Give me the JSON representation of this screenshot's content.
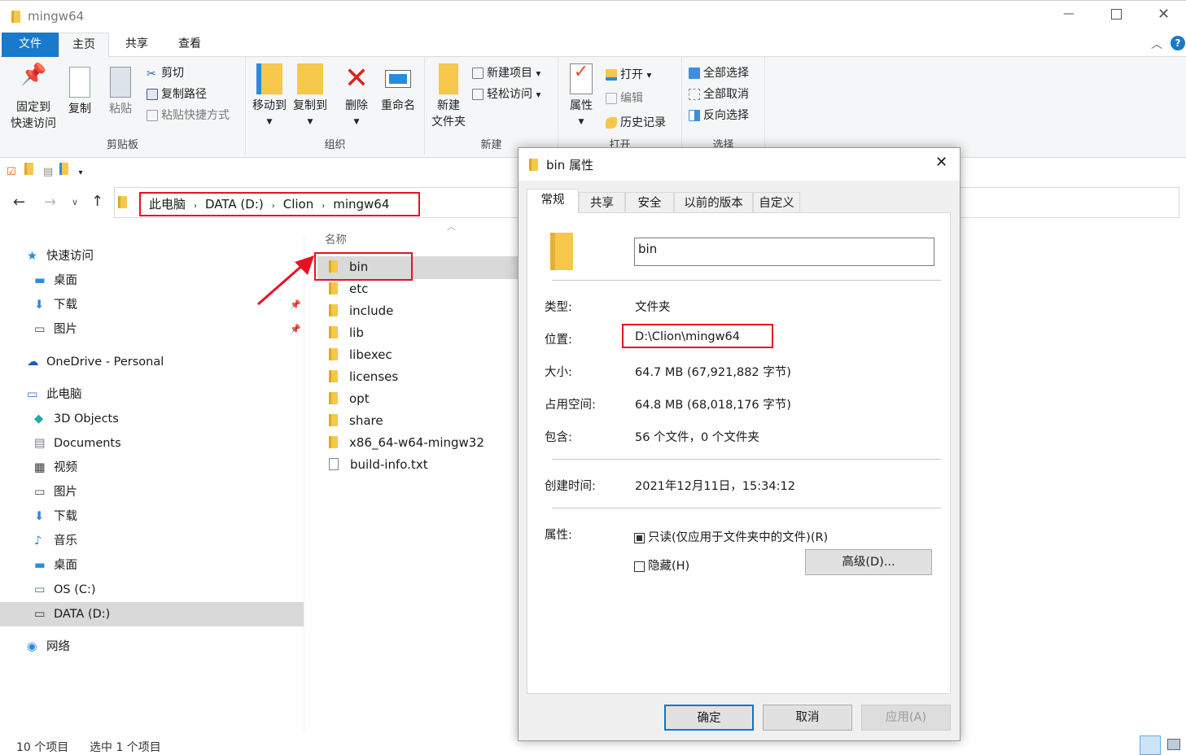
{
  "window": {
    "title": "mingw64"
  },
  "tabs": [
    "文件",
    "主页",
    "共享",
    "查看"
  ],
  "ribbon": {
    "clipboard": {
      "label": "剪贴板",
      "pin": "固定到\n快速访问",
      "copy": "复制",
      "paste": "粘贴",
      "cut": "剪切",
      "copy_path": "复制路径",
      "paste_shortcut": "粘贴快捷方式"
    },
    "organize": {
      "label": "组织",
      "move_to": "移动到",
      "copy_to": "复制到",
      "delete": "删除",
      "rename": "重命名"
    },
    "new": {
      "label": "新建",
      "new_folder": "新建\n文件夹",
      "new_item": "新建项目",
      "easy_access": "轻松访问"
    },
    "open": {
      "label": "打开",
      "properties": "属性",
      "open": "打开",
      "edit": "编辑",
      "history": "历史记录"
    },
    "select": {
      "label": "选择",
      "select_all": "全部选择",
      "select_none": "全部取消",
      "invert": "反向选择"
    }
  },
  "breadcrumb": [
    "此电脑",
    "DATA (D:)",
    "Clion",
    "mingw64"
  ],
  "sidebar": {
    "items": [
      {
        "label": "快速访问",
        "level": 0
      },
      {
        "label": "桌面",
        "level": 1
      },
      {
        "label": "下载",
        "level": 1,
        "pinned": true
      },
      {
        "label": "图片",
        "level": 1,
        "pinned": true
      },
      {
        "label": "OneDrive - Personal",
        "level": 0
      },
      {
        "label": "此电脑",
        "level": 0
      },
      {
        "label": "3D Objects",
        "level": 1
      },
      {
        "label": "Documents",
        "level": 1
      },
      {
        "label": "视频",
        "level": 1
      },
      {
        "label": "图片",
        "level": 1
      },
      {
        "label": "下载",
        "level": 1
      },
      {
        "label": "音乐",
        "level": 1
      },
      {
        "label": "桌面",
        "level": 1
      },
      {
        "label": "OS (C:)",
        "level": 1
      },
      {
        "label": "DATA (D:)",
        "level": 1,
        "selected": true
      },
      {
        "label": "网络",
        "level": 0
      }
    ]
  },
  "filelist": {
    "column": "名称",
    "files": [
      "bin",
      "etc",
      "include",
      "lib",
      "libexec",
      "licenses",
      "opt",
      "share",
      "x86_64-w64-mingw32",
      "build-info.txt"
    ]
  },
  "status": {
    "count": "10 个项目",
    "selected": "选中 1 个项目"
  },
  "dialog": {
    "title": "bin 属性",
    "tabs": [
      "常规",
      "共享",
      "安全",
      "以前的版本",
      "自定义"
    ],
    "name": "bin",
    "rows": [
      {
        "label": "类型:",
        "value": "文件夹"
      },
      {
        "label": "位置:",
        "value": "D:\\Clion\\mingw64"
      },
      {
        "label": "大小:",
        "value": "64.7 MB (67,921,882 字节)"
      },
      {
        "label": "占用空间:",
        "value": "64.8 MB (68,018,176 字节)"
      },
      {
        "label": "包含:",
        "value": "56 个文件，0 个文件夹"
      },
      {
        "label": "创建时间:",
        "value": "2021年12月11日，15:34:12"
      }
    ],
    "attributes_label": "属性:",
    "readonly": "只读(仅应用于文件夹中的文件)(R)",
    "hidden": "隐藏(H)",
    "advanced": "高级(D)...",
    "ok": "确定",
    "cancel": "取消",
    "apply": "应用(A)"
  },
  "colors": {
    "accent": "#1979ca",
    "highlight": "#e81123"
  }
}
